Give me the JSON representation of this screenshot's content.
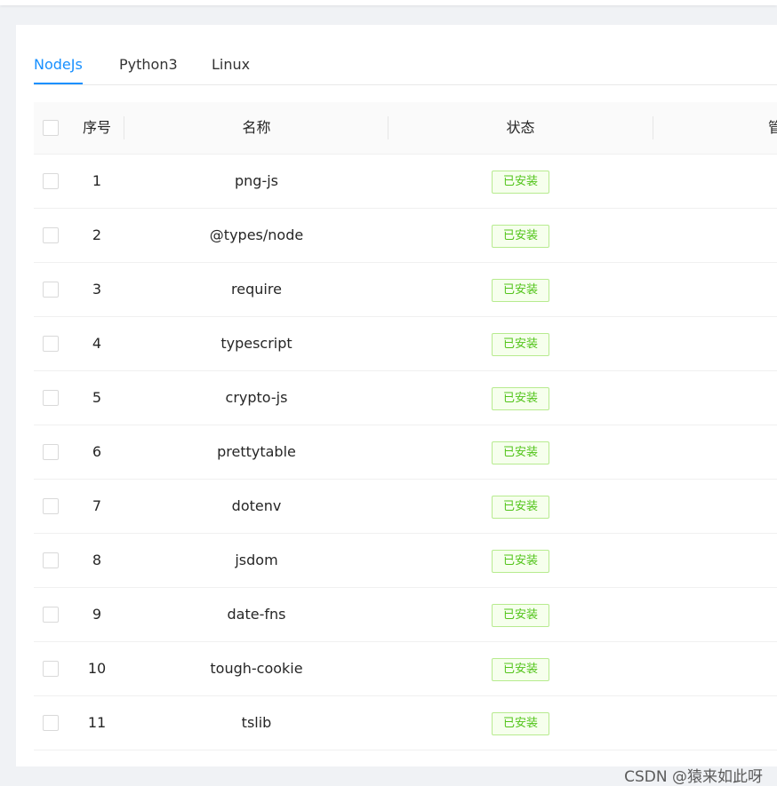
{
  "tabs": [
    {
      "label": "NodeJs",
      "active": true
    },
    {
      "label": "Python3",
      "active": false
    },
    {
      "label": "Linux",
      "active": false
    }
  ],
  "table": {
    "headers": {
      "index": "序号",
      "name": "名称",
      "status": "状态",
      "actions_partial": "管"
    },
    "rows": [
      {
        "index": "1",
        "name": "png-js",
        "status": "已安装"
      },
      {
        "index": "2",
        "name": "@types/node",
        "status": "已安装"
      },
      {
        "index": "3",
        "name": "require",
        "status": "已安装"
      },
      {
        "index": "4",
        "name": "typescript",
        "status": "已安装"
      },
      {
        "index": "5",
        "name": "crypto-js",
        "status": "已安装"
      },
      {
        "index": "6",
        "name": "prettytable",
        "status": "已安装"
      },
      {
        "index": "7",
        "name": "dotenv",
        "status": "已安装"
      },
      {
        "index": "8",
        "name": "jsdom",
        "status": "已安装"
      },
      {
        "index": "9",
        "name": "date-fns",
        "status": "已安装"
      },
      {
        "index": "10",
        "name": "tough-cookie",
        "status": "已安装"
      },
      {
        "index": "11",
        "name": "tslib",
        "status": "已安装"
      }
    ]
  },
  "watermark": "CSDN @猿来如此呀",
  "colors": {
    "accent": "#1890ff",
    "success_text": "#52c41a",
    "success_bg": "#f6ffed",
    "success_border": "#b7eb8f"
  }
}
